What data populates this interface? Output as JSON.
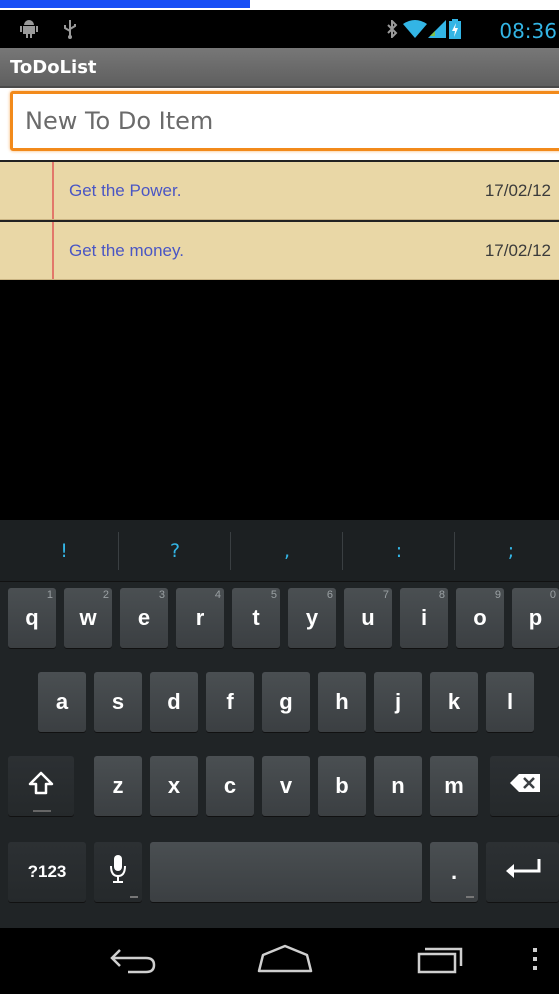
{
  "status_bar": {
    "time": "08:36",
    "icons": [
      "android-debug-icon",
      "usb-icon",
      "bluetooth-icon",
      "wifi-icon",
      "signal-icon",
      "battery-icon"
    ],
    "accent_color": "#33b5e5"
  },
  "app": {
    "title": "ToDoList"
  },
  "input": {
    "placeholder": "New To Do Item",
    "value": ""
  },
  "todo_items": [
    {
      "task": "Get the Power.",
      "date": "17/02/12"
    },
    {
      "task": "Get the money.",
      "date": "17/02/12"
    }
  ],
  "keyboard": {
    "suggestions": [
      "!",
      "?",
      ",",
      ":",
      ";"
    ],
    "row1": [
      {
        "label": "q",
        "hint": "1"
      },
      {
        "label": "w",
        "hint": "2"
      },
      {
        "label": "e",
        "hint": "3"
      },
      {
        "label": "r",
        "hint": "4"
      },
      {
        "label": "t",
        "hint": "5"
      },
      {
        "label": "y",
        "hint": "6"
      },
      {
        "label": "u",
        "hint": "7"
      },
      {
        "label": "i",
        "hint": "8"
      },
      {
        "label": "o",
        "hint": "9"
      },
      {
        "label": "p",
        "hint": "0"
      }
    ],
    "row2": [
      "a",
      "s",
      "d",
      "f",
      "g",
      "h",
      "j",
      "k",
      "l"
    ],
    "row3": [
      "z",
      "x",
      "c",
      "v",
      "b",
      "n",
      "m"
    ],
    "symbols_label": "?123",
    "period_label": "."
  },
  "nav_bar": {
    "buttons": [
      "back-icon",
      "home-icon",
      "recents-icon",
      "menu-icon"
    ]
  }
}
